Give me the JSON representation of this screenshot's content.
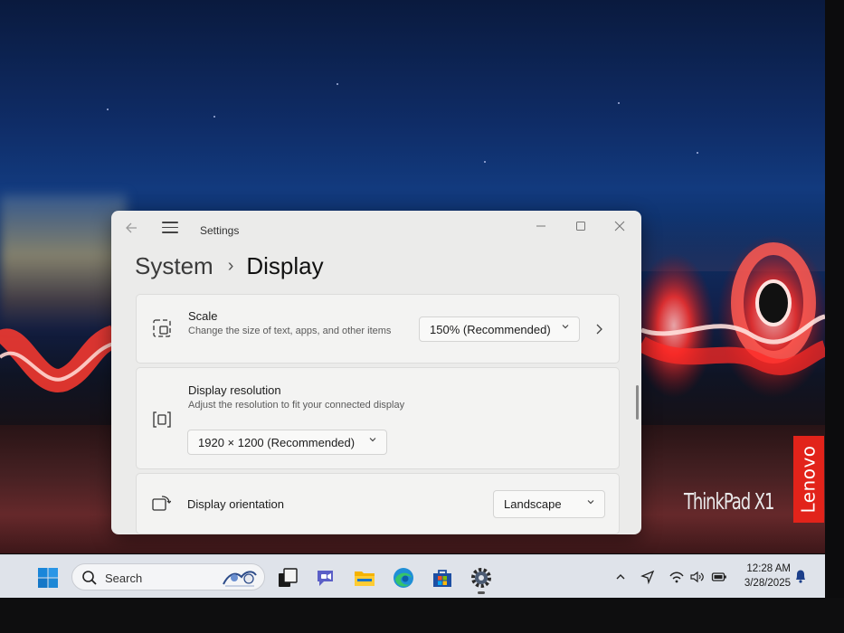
{
  "window": {
    "title": "Settings",
    "breadcrumb_parent": "System",
    "breadcrumb_separator": "›",
    "breadcrumb_current": "Display"
  },
  "scale": {
    "title": "Scale",
    "description": "Change the size of text, apps, and other items",
    "selected": "150% (Recommended)"
  },
  "resolution": {
    "title": "Display resolution",
    "description": "Adjust the resolution to fit your connected display",
    "selected": "1920 × 1200 (Recommended)"
  },
  "orientation": {
    "title": "Display orientation",
    "selected": "Landscape"
  },
  "taskbar": {
    "search_label": "Search",
    "time": "12:28 AM",
    "date": "3/28/2025"
  },
  "branding": {
    "thinkpad": "ThinkPad X1",
    "lenovo": "Lenovo"
  },
  "colors": {
    "window_bg": "#ebebea",
    "card_bg": "#f3f3f2",
    "taskbar_bg": "#dfe3ea",
    "lenovo_red": "#e2231a",
    "edge_blue": "#1f8fd6",
    "store_blue": "#1d4fa3",
    "chat_purple": "#5b5fc7"
  },
  "icons": {
    "start": "windows-start-icon",
    "search": "search-icon",
    "task_view": "task-view-icon",
    "chat": "chat-icon",
    "file_explorer": "folder-icon",
    "edge": "edge-icon",
    "store": "store-icon",
    "settings": "gear-icon",
    "tray_chevron": "chevron-up-icon",
    "location": "location-icon",
    "wifi": "wifi-icon",
    "volume": "volume-icon",
    "battery": "battery-icon",
    "notifications": "bell-icon"
  }
}
